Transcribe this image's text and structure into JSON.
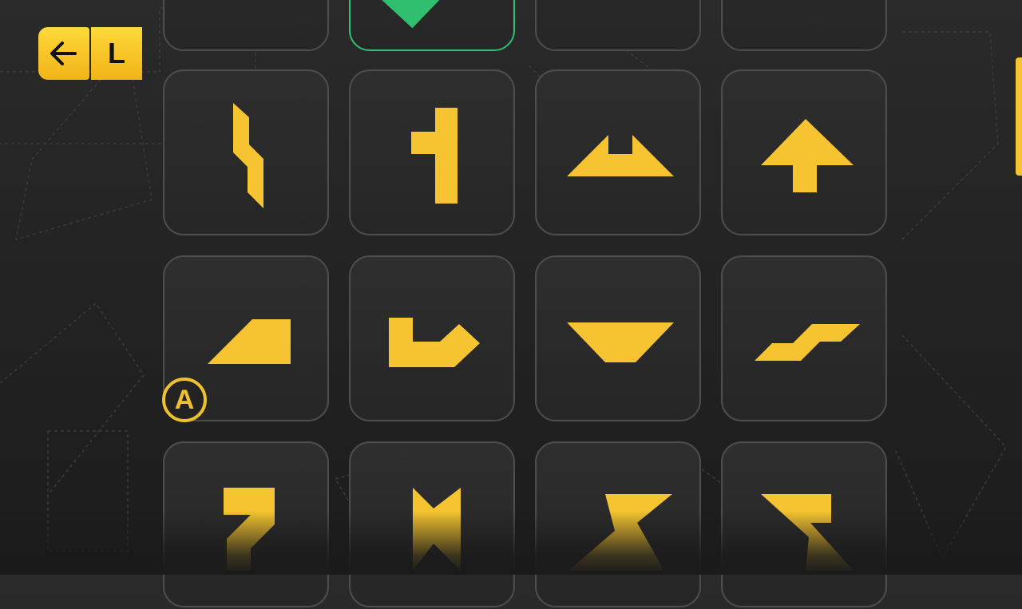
{
  "header": {
    "back_icon": "arrow-left-icon",
    "shoulder_label": "L"
  },
  "hint": {
    "button_label": "A"
  },
  "colors": {
    "piece": "#f5c430",
    "tile_border": "#4d4d4d",
    "solved_border": "#2fbf6f",
    "background": "#242424"
  },
  "grid": {
    "columns": 4,
    "tiles": [
      {
        "name": "puzzle-tile-1",
        "shape": "partial",
        "solved": false
      },
      {
        "name": "puzzle-tile-2",
        "shape": "partial",
        "solved": true
      },
      {
        "name": "puzzle-tile-3",
        "shape": "partial",
        "solved": false
      },
      {
        "name": "puzzle-tile-4",
        "shape": "partial",
        "solved": false
      },
      {
        "name": "puzzle-tile-5",
        "shape": "zigzag-bar",
        "solved": false
      },
      {
        "name": "puzzle-tile-6",
        "shape": "t-post",
        "solved": false
      },
      {
        "name": "puzzle-tile-7",
        "shape": "notched-trapezoid",
        "solved": false
      },
      {
        "name": "puzzle-tile-8",
        "shape": "arrow-up",
        "solved": false
      },
      {
        "name": "puzzle-tile-9",
        "shape": "ramp",
        "solved": false
      },
      {
        "name": "puzzle-tile-10",
        "shape": "boot",
        "solved": false
      },
      {
        "name": "puzzle-tile-11",
        "shape": "v-trough",
        "solved": false
      },
      {
        "name": "puzzle-tile-12",
        "shape": "step-flag",
        "solved": false
      },
      {
        "name": "puzzle-tile-13",
        "shape": "seven",
        "solved": false
      },
      {
        "name": "puzzle-tile-14",
        "shape": "arrow-down-notch",
        "solved": false
      },
      {
        "name": "puzzle-tile-15",
        "shape": "z-bolt",
        "solved": false
      },
      {
        "name": "puzzle-tile-16",
        "shape": "s-bolt",
        "solved": false
      }
    ]
  }
}
